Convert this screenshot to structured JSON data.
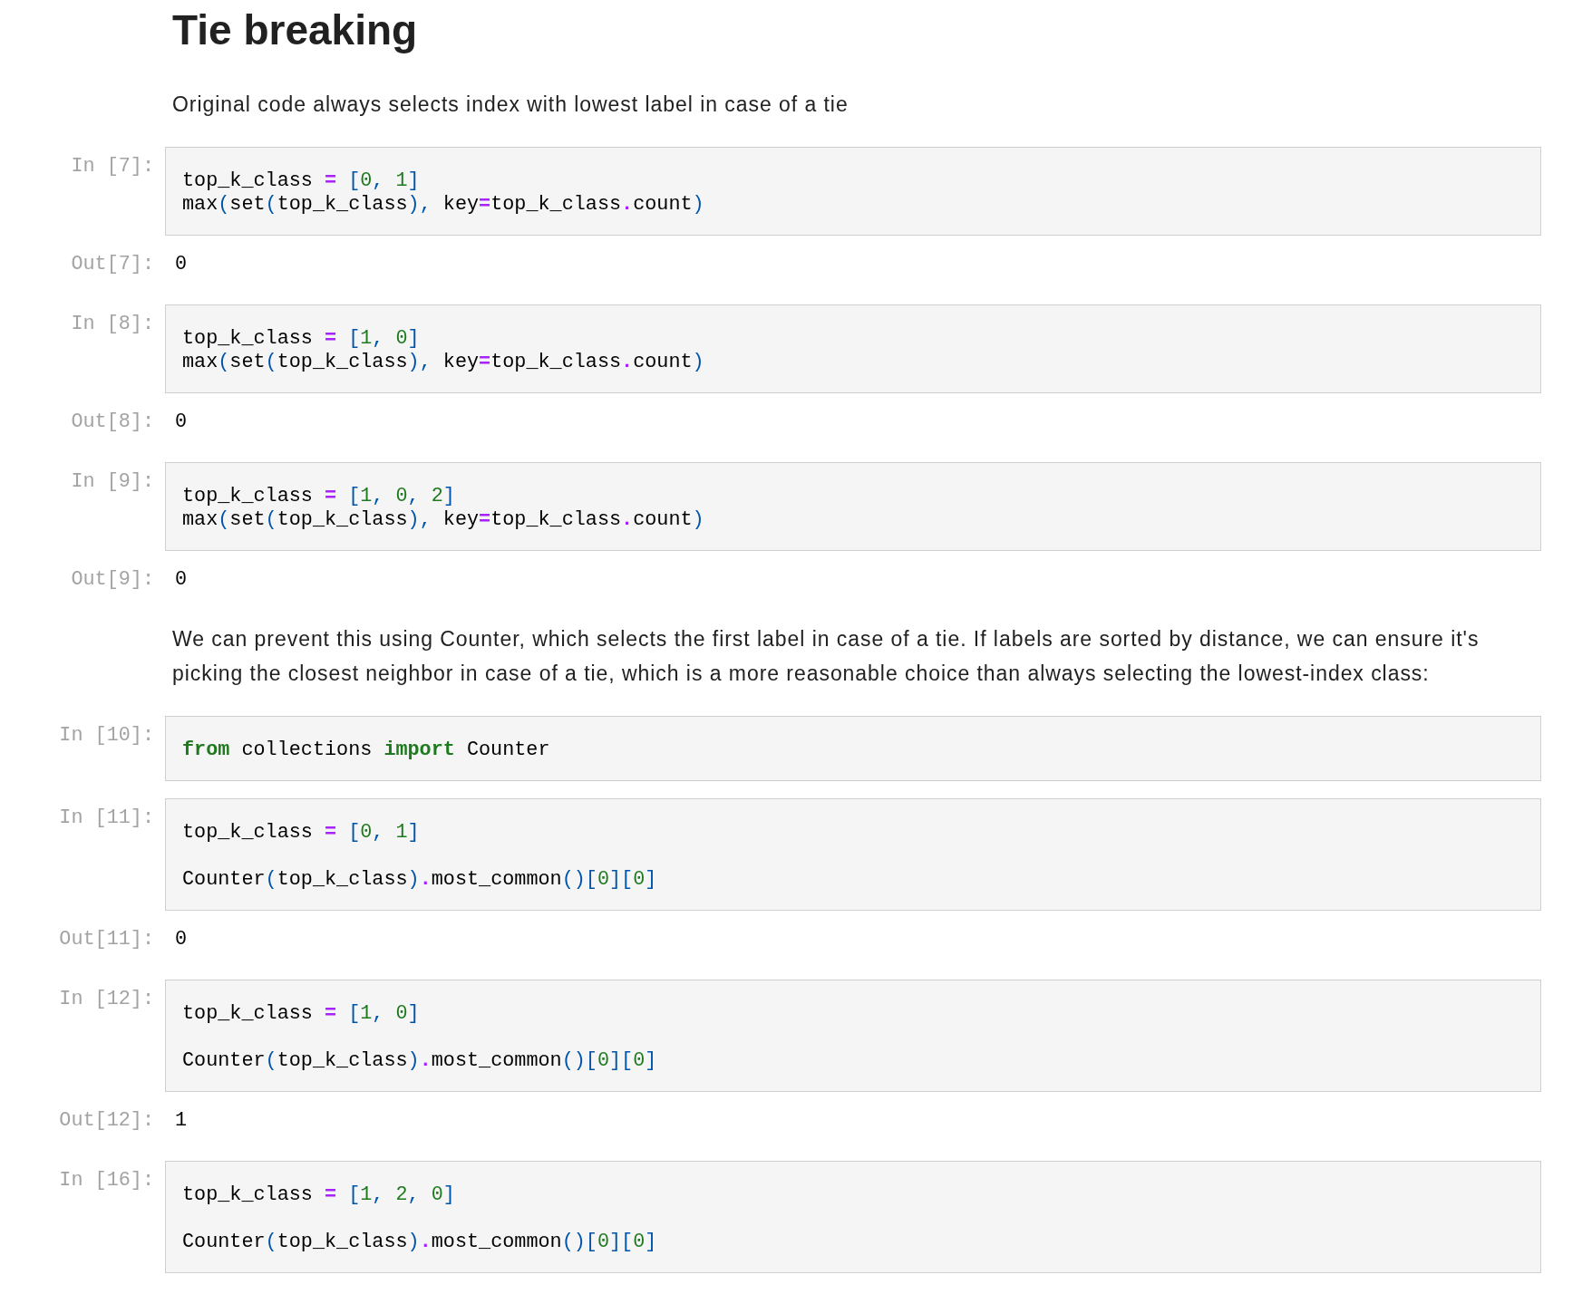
{
  "cells": [
    {
      "kind": "markdown",
      "heading": "Tie breaking",
      "paragraphs": [
        "Original code always selects index with lowest label in case of a tie"
      ]
    },
    {
      "kind": "code",
      "prompt": "In [7]:",
      "lines": [
        {
          "kind": "code",
          "tokens": [
            {
              "kind": "name",
              "text": "top_k_class "
            },
            {
              "kind": "op",
              "text": "="
            },
            {
              "kind": "punct",
              "text": " ["
            },
            {
              "kind": "number",
              "text": "0"
            },
            {
              "kind": "punct",
              "text": ", "
            },
            {
              "kind": "number",
              "text": "1"
            },
            {
              "kind": "punct",
              "text": "]"
            }
          ]
        },
        {
          "kind": "code",
          "tokens": [
            {
              "kind": "name",
              "text": "max"
            },
            {
              "kind": "punct",
              "text": "("
            },
            {
              "kind": "name",
              "text": "set"
            },
            {
              "kind": "punct",
              "text": "("
            },
            {
              "kind": "name",
              "text": "top_k_class"
            },
            {
              "kind": "punct",
              "text": "), "
            },
            {
              "kind": "name",
              "text": "key"
            },
            {
              "kind": "op",
              "text": "="
            },
            {
              "kind": "name",
              "text": "top_k_class"
            },
            {
              "kind": "op",
              "text": "."
            },
            {
              "kind": "name",
              "text": "count"
            },
            {
              "kind": "punct",
              "text": ")"
            }
          ]
        }
      ],
      "output": {
        "prompt": "Out[7]:",
        "text": "0"
      }
    },
    {
      "kind": "code",
      "prompt": "In [8]:",
      "lines": [
        {
          "kind": "code",
          "tokens": [
            {
              "kind": "name",
              "text": "top_k_class "
            },
            {
              "kind": "op",
              "text": "="
            },
            {
              "kind": "punct",
              "text": " ["
            },
            {
              "kind": "number",
              "text": "1"
            },
            {
              "kind": "punct",
              "text": ", "
            },
            {
              "kind": "number",
              "text": "0"
            },
            {
              "kind": "punct",
              "text": "]"
            }
          ]
        },
        {
          "kind": "code",
          "tokens": [
            {
              "kind": "name",
              "text": "max"
            },
            {
              "kind": "punct",
              "text": "("
            },
            {
              "kind": "name",
              "text": "set"
            },
            {
              "kind": "punct",
              "text": "("
            },
            {
              "kind": "name",
              "text": "top_k_class"
            },
            {
              "kind": "punct",
              "text": "), "
            },
            {
              "kind": "name",
              "text": "key"
            },
            {
              "kind": "op",
              "text": "="
            },
            {
              "kind": "name",
              "text": "top_k_class"
            },
            {
              "kind": "op",
              "text": "."
            },
            {
              "kind": "name",
              "text": "count"
            },
            {
              "kind": "punct",
              "text": ")"
            }
          ]
        }
      ],
      "output": {
        "prompt": "Out[8]:",
        "text": "0"
      }
    },
    {
      "kind": "code",
      "prompt": "In [9]:",
      "lines": [
        {
          "kind": "code",
          "tokens": [
            {
              "kind": "name",
              "text": "top_k_class "
            },
            {
              "kind": "op",
              "text": "="
            },
            {
              "kind": "punct",
              "text": " ["
            },
            {
              "kind": "number",
              "text": "1"
            },
            {
              "kind": "punct",
              "text": ", "
            },
            {
              "kind": "number",
              "text": "0"
            },
            {
              "kind": "punct",
              "text": ", "
            },
            {
              "kind": "number",
              "text": "2"
            },
            {
              "kind": "punct",
              "text": "]"
            }
          ]
        },
        {
          "kind": "code",
          "tokens": [
            {
              "kind": "name",
              "text": "max"
            },
            {
              "kind": "punct",
              "text": "("
            },
            {
              "kind": "name",
              "text": "set"
            },
            {
              "kind": "punct",
              "text": "("
            },
            {
              "kind": "name",
              "text": "top_k_class"
            },
            {
              "kind": "punct",
              "text": "), "
            },
            {
              "kind": "name",
              "text": "key"
            },
            {
              "kind": "op",
              "text": "="
            },
            {
              "kind": "name",
              "text": "top_k_class"
            },
            {
              "kind": "op",
              "text": "."
            },
            {
              "kind": "name",
              "text": "count"
            },
            {
              "kind": "punct",
              "text": ")"
            }
          ]
        }
      ],
      "output": {
        "prompt": "Out[9]:",
        "text": "0"
      }
    },
    {
      "kind": "markdown",
      "paragraphs": [
        "We can prevent this using Counter, which selects the first label in case of a tie. If labels are sorted by distance, we can ensure it's picking the closest neighbor in case of a tie, which is a more reasonable choice than always selecting the lowest-index class:"
      ]
    },
    {
      "kind": "code",
      "prompt": "In [10]:",
      "lines": [
        {
          "kind": "code",
          "tokens": [
            {
              "kind": "keyword",
              "text": "from"
            },
            {
              "kind": "name",
              "text": " collections "
            },
            {
              "kind": "keyword",
              "text": "import"
            },
            {
              "kind": "name",
              "text": " Counter"
            }
          ]
        }
      ]
    },
    {
      "kind": "code",
      "prompt": "In [11]:",
      "lines": [
        {
          "kind": "code",
          "tokens": [
            {
              "kind": "name",
              "text": "top_k_class "
            },
            {
              "kind": "op",
              "text": "="
            },
            {
              "kind": "punct",
              "text": " ["
            },
            {
              "kind": "number",
              "text": "0"
            },
            {
              "kind": "punct",
              "text": ", "
            },
            {
              "kind": "number",
              "text": "1"
            },
            {
              "kind": "punct",
              "text": "]"
            }
          ]
        },
        {
          "kind": "blank"
        },
        {
          "kind": "code",
          "tokens": [
            {
              "kind": "name",
              "text": "Counter"
            },
            {
              "kind": "punct",
              "text": "("
            },
            {
              "kind": "name",
              "text": "top_k_class"
            },
            {
              "kind": "punct",
              "text": ")"
            },
            {
              "kind": "op",
              "text": "."
            },
            {
              "kind": "name",
              "text": "most_common"
            },
            {
              "kind": "punct",
              "text": "()["
            },
            {
              "kind": "number",
              "text": "0"
            },
            {
              "kind": "punct",
              "text": "]["
            },
            {
              "kind": "number",
              "text": "0"
            },
            {
              "kind": "punct",
              "text": "]"
            }
          ]
        }
      ],
      "output": {
        "prompt": "Out[11]:",
        "text": "0"
      }
    },
    {
      "kind": "code",
      "prompt": "In [12]:",
      "lines": [
        {
          "kind": "code",
          "tokens": [
            {
              "kind": "name",
              "text": "top_k_class "
            },
            {
              "kind": "op",
              "text": "="
            },
            {
              "kind": "punct",
              "text": " ["
            },
            {
              "kind": "number",
              "text": "1"
            },
            {
              "kind": "punct",
              "text": ", "
            },
            {
              "kind": "number",
              "text": "0"
            },
            {
              "kind": "punct",
              "text": "]"
            }
          ]
        },
        {
          "kind": "blank"
        },
        {
          "kind": "code",
          "tokens": [
            {
              "kind": "name",
              "text": "Counter"
            },
            {
              "kind": "punct",
              "text": "("
            },
            {
              "kind": "name",
              "text": "top_k_class"
            },
            {
              "kind": "punct",
              "text": ")"
            },
            {
              "kind": "op",
              "text": "."
            },
            {
              "kind": "name",
              "text": "most_common"
            },
            {
              "kind": "punct",
              "text": "()["
            },
            {
              "kind": "number",
              "text": "0"
            },
            {
              "kind": "punct",
              "text": "]["
            },
            {
              "kind": "number",
              "text": "0"
            },
            {
              "kind": "punct",
              "text": "]"
            }
          ]
        }
      ],
      "output": {
        "prompt": "Out[12]:",
        "text": "1"
      }
    },
    {
      "kind": "code",
      "prompt": "In [16]:",
      "lines": [
        {
          "kind": "code",
          "tokens": [
            {
              "kind": "name",
              "text": "top_k_class "
            },
            {
              "kind": "op",
              "text": "="
            },
            {
              "kind": "punct",
              "text": " ["
            },
            {
              "kind": "number",
              "text": "1"
            },
            {
              "kind": "punct",
              "text": ", "
            },
            {
              "kind": "number",
              "text": "2"
            },
            {
              "kind": "punct",
              "text": ", "
            },
            {
              "kind": "number",
              "text": "0"
            },
            {
              "kind": "punct",
              "text": "]"
            }
          ]
        },
        {
          "kind": "blank"
        },
        {
          "kind": "code",
          "tokens": [
            {
              "kind": "name",
              "text": "Counter"
            },
            {
              "kind": "punct",
              "text": "("
            },
            {
              "kind": "name",
              "text": "top_k_class"
            },
            {
              "kind": "punct",
              "text": ")"
            },
            {
              "kind": "op",
              "text": "."
            },
            {
              "kind": "name",
              "text": "most_common"
            },
            {
              "kind": "punct",
              "text": "()["
            },
            {
              "kind": "number",
              "text": "0"
            },
            {
              "kind": "punct",
              "text": "]["
            },
            {
              "kind": "number",
              "text": "0"
            },
            {
              "kind": "punct",
              "text": "]"
            }
          ]
        }
      ]
    }
  ]
}
